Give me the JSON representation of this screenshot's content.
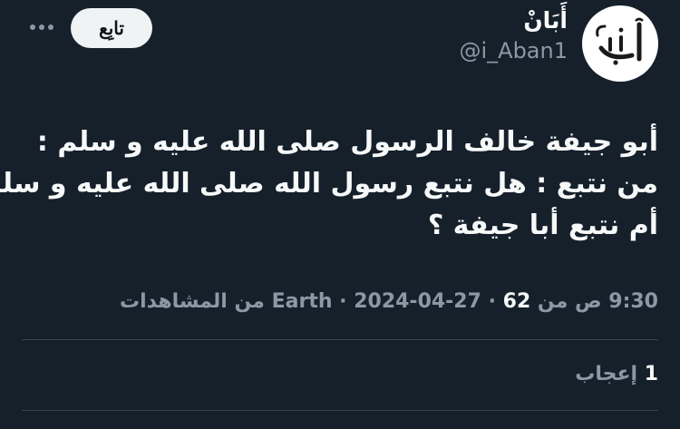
{
  "author": {
    "display_name": "أَبَانْ",
    "handle": "@i_Aban1",
    "avatar_text": "أبان"
  },
  "follow_button_label": "تابِع",
  "more_icon": "more-dots-icon",
  "tweet": {
    "lines": [
      "أبو جيفة خالف الرسول صلى الله عليه و سلم :",
      "من نتبع : هل نتبع رسول الله صلى الله عليه و سلم",
      "أم نتبع أبا جيفة ؟"
    ]
  },
  "meta": {
    "date": "2024-04-27",
    "time": "9:30 ص من Earth",
    "separator": "·",
    "views_count": "62",
    "views_label": "من المشاهدات"
  },
  "likes": {
    "count": "1",
    "label": "إعجاب"
  },
  "colors": {
    "background": "#15202b",
    "text_primary": "#f7f9f9",
    "text_secondary": "#8b98a5",
    "divider": "#38444d",
    "follow_button_bg": "#eff3f4"
  }
}
